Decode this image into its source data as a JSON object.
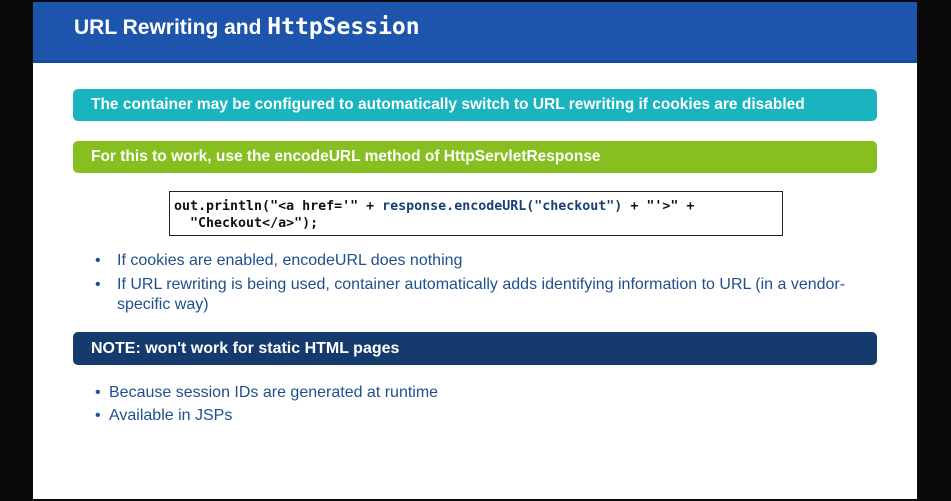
{
  "title": {
    "prefix": "URL Rewriting and ",
    "code_word": "HttpSession"
  },
  "banners": {
    "container_note": "The container may be configured to automatically switch to URL rewriting if cookies are disabled",
    "how_to": "For this to work,  use the encodeURL method of HttpServletResponse",
    "static_note": "NOTE: won't work for static HTML pages"
  },
  "code": {
    "line1_start": "out.println(\"<a href='\" + ",
    "line1_blue": "response.encodeURL(\"checkout\")",
    "line1_end": " + \"'>\" +",
    "line2": "  \"Checkout</a>\");"
  },
  "bullets_main": [
    "If cookies are enabled, encodeURL does nothing",
    "If URL rewriting is being used, container automatically adds identifying information to URL (in a vendor-specific way)"
  ],
  "bullets_note": [
    "Because session IDs are generated at runtime",
    "Available in JSPs"
  ],
  "colors": {
    "title_bar": "#1d55ad",
    "teal_banner": "#1ab4c0",
    "green_banner": "#86bf1f",
    "navy_banner": "#143a6e",
    "bullet_text": "#1f4f8f"
  }
}
